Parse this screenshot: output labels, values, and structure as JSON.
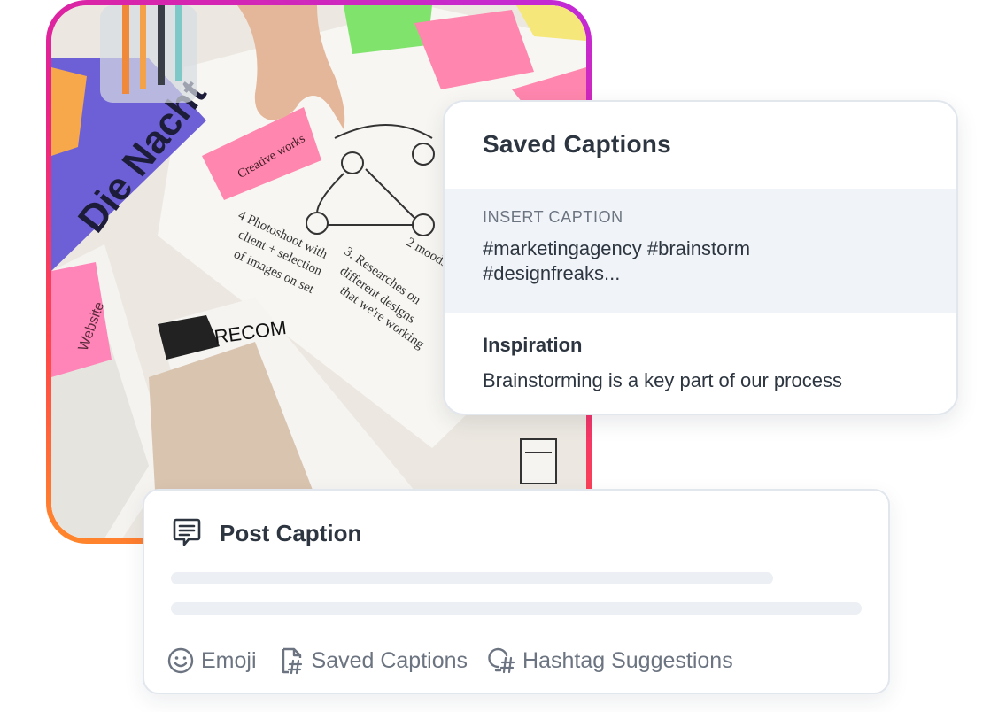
{
  "saved_captions": {
    "title": "Saved Captions",
    "items": [
      {
        "label": "INSERT CAPTION",
        "text": "#marketingagency #brainstorm #designfreaks..."
      },
      {
        "title": "Inspiration",
        "text": "Brainstorming is a key part of our process"
      }
    ]
  },
  "post_caption": {
    "title": "Post Caption",
    "toolbar": [
      {
        "icon": "emoji-icon",
        "label": "Emoji"
      },
      {
        "icon": "saved-captions-icon",
        "label": "Saved Captions"
      },
      {
        "icon": "hashtag-suggestions-icon",
        "label": "Hashtag Suggestions"
      }
    ]
  },
  "photo": {
    "frame_gradient": [
      "#c22ad8",
      "#e8228a",
      "#ff4a46",
      "#ff8a2a"
    ],
    "sticky_notes": [
      "Creative works",
      "Website"
    ]
  }
}
